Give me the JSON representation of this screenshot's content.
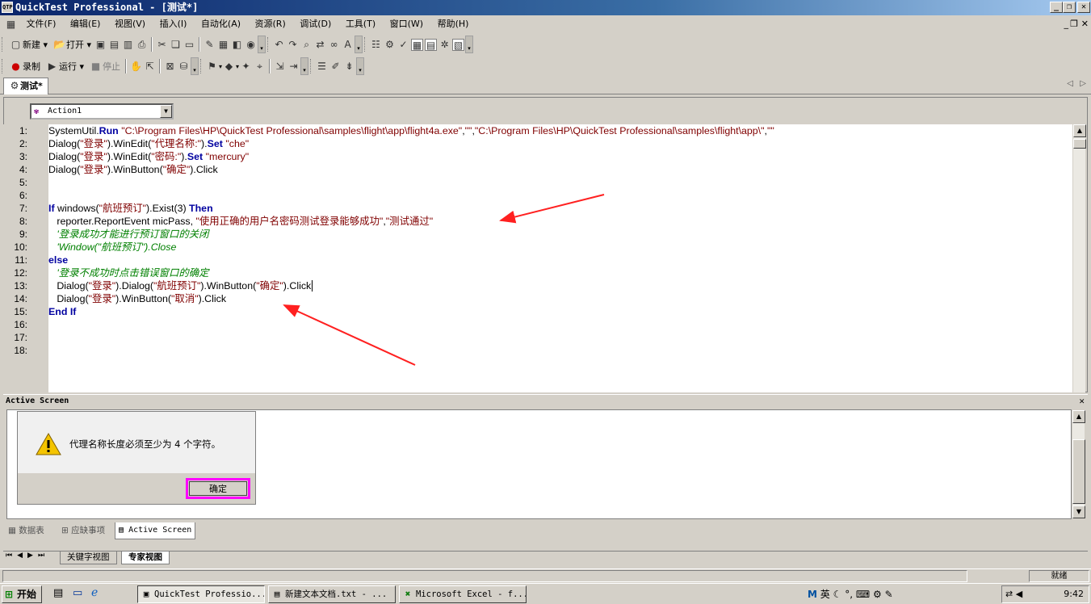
{
  "window": {
    "title": "QuickTest Professional - [测试*]",
    "app_icon": "qtp-app-icon"
  },
  "menu": [
    "文件(F)",
    "编辑(E)",
    "视图(V)",
    "插入(I)",
    "自动化(A)",
    "资源(R)",
    "调试(D)",
    "工具(T)",
    "窗口(W)",
    "帮助(H)"
  ],
  "toolbar1": {
    "new_label": "新建",
    "open_label": "打开"
  },
  "toolbar2": {
    "record_label": "录制",
    "run_label": "运行",
    "stop_label": "停止"
  },
  "doc_tab": {
    "label": "测试*"
  },
  "editor": {
    "action_selector": "Action1",
    "line_numbers": [
      "1:",
      "2:",
      "3:",
      "4:",
      "5:",
      "6:",
      "7:",
      "8:",
      "9:",
      "10:",
      "11:",
      "12:",
      "13:",
      "14:",
      "15:",
      "16:",
      "17:",
      "18:"
    ]
  },
  "active_screen": {
    "header": "Active Screen",
    "dialog_message": "代理名称长度必须至少为 4 个字符。",
    "dialog_ok": "确定"
  },
  "bottom_tabs": [
    "数据表",
    "应缺事项",
    "Active Screen"
  ],
  "view_tabs": [
    "关键字视图",
    "专家视图"
  ],
  "status": {
    "ready": "就绪"
  },
  "taskbar": {
    "start": "开始",
    "tasks": [
      "QuickTest Professio...",
      "新建文本文档.txt - ...",
      "Microsoft Excel - f..."
    ],
    "clock": "9:42",
    "ime_label": "英"
  },
  "colors": {
    "keyword": "#0000a0",
    "string": "#800000",
    "comment": "#008000",
    "highlight_border": "#ff00ff",
    "annotation_arrow": "#ff2020"
  }
}
